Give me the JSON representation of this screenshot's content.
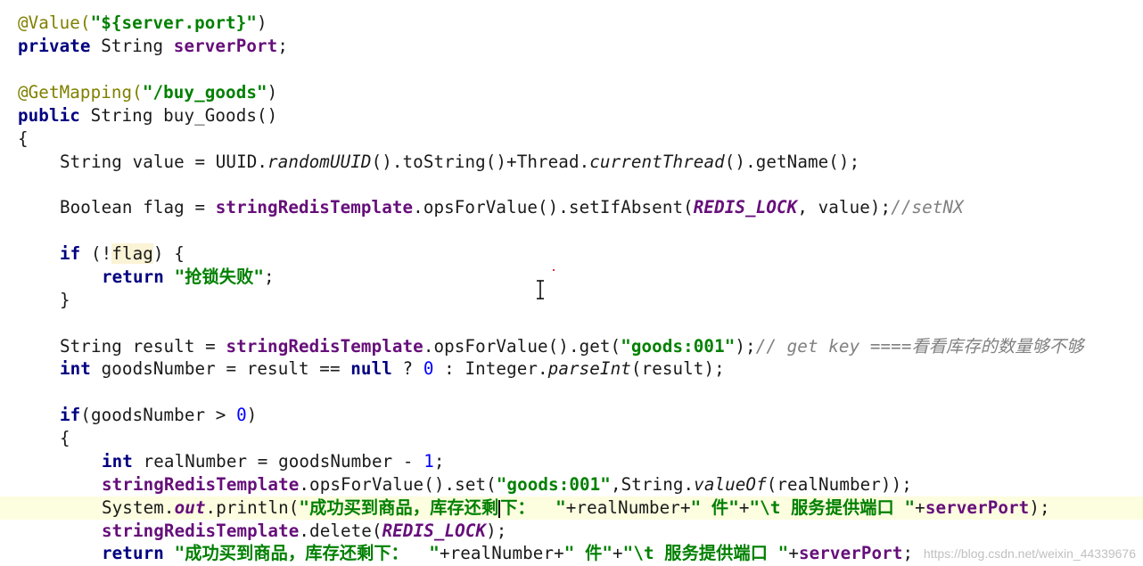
{
  "code": {
    "l1": {
      "ann": "@Value(",
      "str": "\"${server.port}\"",
      "rest": ")"
    },
    "l2": {
      "kw": "private",
      "t1": " String ",
      "fld": "serverPort",
      "t2": ";"
    },
    "l4": {
      "ann": "@GetMapping(",
      "str": "\"/buy_goods\"",
      "rest": ")"
    },
    "l5": {
      "kw": "public",
      "t1": " String buy_Goods()"
    },
    "l6": {
      "t1": "{"
    },
    "l7": {
      "t1": "String value = UUID.",
      "i1": "randomUUID",
      "t2": "().toString()+Thread.",
      "i2": "currentThread",
      "t3": "().getName();"
    },
    "l9": {
      "t1": "Boolean flag = ",
      "fld": "stringRedisTemplate",
      "t2": ".opsForValue().setIfAbsent(",
      "const": "REDIS_LOCK",
      "t3": ", value);",
      "cmt": "//setNX"
    },
    "l11": {
      "kw": "if",
      "t1": " (!",
      "hl": "flag",
      "t2": ") {"
    },
    "l12": {
      "kw": "return",
      "t1": " ",
      "str": "\"抢锁失败\"",
      "t2": ";"
    },
    "l13": {
      "t1": "}"
    },
    "l15": {
      "t1": "String result = ",
      "fld": "stringRedisTemplate",
      "t2": ".opsForValue().get(",
      "str": "\"goods:001\"",
      "t3": ");",
      "cmt": "// get key ====看看库存的数量够不够"
    },
    "l16": {
      "kw": "int",
      "t1": " goodsNumber = result == ",
      "kw2": "null",
      "t2": " ? ",
      "n1": "0",
      "t3": " : Integer.",
      "i1": "parseInt",
      "t4": "(result);"
    },
    "l18": {
      "kw": "if",
      "t1": "(goodsNumber > ",
      "n1": "0",
      "t2": ")"
    },
    "l19": {
      "t1": "{"
    },
    "l20": {
      "kw": "int",
      "t1": " realNumber = goodsNumber - ",
      "n1": "1",
      "t2": ";"
    },
    "l21": {
      "fld": "stringRedisTemplate",
      "t1": ".opsForValue().set(",
      "str": "\"goods:001\"",
      "t2": ",String.",
      "i1": "valueOf",
      "t3": "(realNumber));"
    },
    "l22": {
      "t1": "System.",
      "const": "out",
      "t2": ".println(",
      "s1a": "\"成功买到商品，库存还剩",
      "s1b": "下：  \"",
      "t3": "+realNumber+",
      "s2": "\" 件\"",
      "t4": "+",
      "s3": "\"\\t 服务提供端口 \"",
      "t5": "+",
      "fld": "serverPort",
      "t6": ");"
    },
    "l23": {
      "fld": "stringRedisTemplate",
      "t1": ".delete(",
      "const": "REDIS_LOCK",
      "t2": ");"
    },
    "l24": {
      "kw": "return",
      "t1": " ",
      "s1": "\"成功买到商品，库存还剩下：  \"",
      "t2": "+realNumber+",
      "s2": "\" 件\"",
      "t3": "+",
      "s3": "\"\\t 服务提供端口 \"",
      "t4": "+",
      "fld": "serverPort",
      "t5": ";"
    }
  },
  "watermark": "https://blog.csdn.net/weixin_44339676",
  "colors": {
    "keyword": "#000080",
    "annotation": "#808000",
    "string": "#008000",
    "field": "#660e7a",
    "comment": "#808080",
    "number": "#0000ff",
    "current_line": "#fdfde0"
  }
}
